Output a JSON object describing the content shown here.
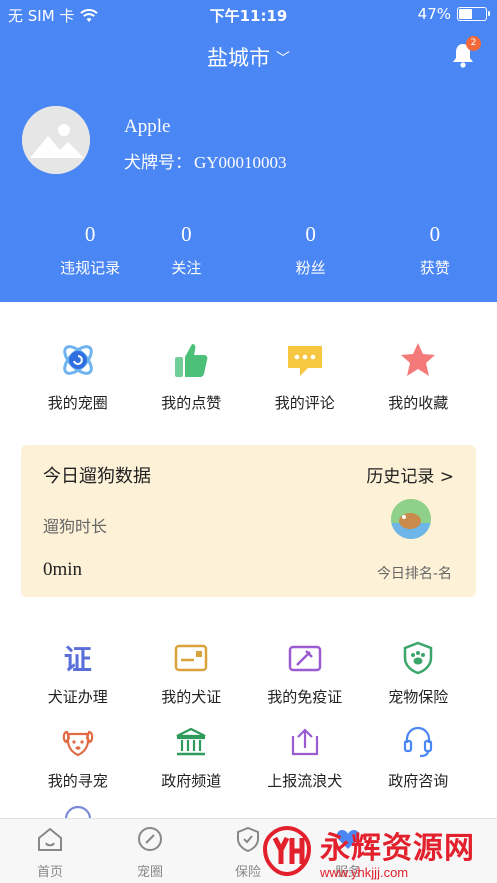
{
  "status_bar": {
    "carrier": "无 SIM 卡",
    "time": "下午11:19",
    "battery": "47%",
    "battery_level": 0.47
  },
  "header": {
    "city": "盐城市",
    "notification_count": "2",
    "user_name": "Apple",
    "dog_tag_label": "犬牌号：",
    "dog_tag_value": "GY00010003",
    "stats": [
      {
        "value": "0",
        "label": "违规记录"
      },
      {
        "value": "0",
        "label": "关注"
      },
      {
        "value": "0",
        "label": "粉丝"
      },
      {
        "value": "0",
        "label": "获赞"
      }
    ]
  },
  "quick_links": [
    {
      "label": "我的宠圈",
      "icon": "pet-circle-icon"
    },
    {
      "label": "我的点赞",
      "icon": "thumbs-up-icon"
    },
    {
      "label": "我的评论",
      "icon": "comment-icon"
    },
    {
      "label": "我的收藏",
      "icon": "star-icon"
    }
  ],
  "walk_card": {
    "title": "今日遛狗数据",
    "history": "历史记录 >",
    "duration_label": "遛狗时长",
    "duration_value": "0min",
    "rank": "今日排名-名"
  },
  "services": [
    {
      "label": "犬证办理",
      "icon": "license-icon"
    },
    {
      "label": "我的犬证",
      "icon": "card-icon"
    },
    {
      "label": "我的免疫证",
      "icon": "vaccine-icon"
    },
    {
      "label": "宠物保险",
      "icon": "shield-paw-icon"
    },
    {
      "label": "我的寻宠",
      "icon": "dog-face-icon"
    },
    {
      "label": "政府频道",
      "icon": "government-icon"
    },
    {
      "label": "上报流浪犬",
      "icon": "upload-icon"
    },
    {
      "label": "政府咨询",
      "icon": "headset-icon"
    }
  ],
  "tabs": [
    {
      "label": "首页",
      "icon": "home-icon"
    },
    {
      "label": "宠圈",
      "icon": "compass-icon"
    },
    {
      "label": "保险",
      "icon": "shield-icon"
    },
    {
      "label": "服务",
      "icon": "service-icon"
    }
  ],
  "watermark": {
    "brand": "永辉资源网",
    "url": "www.yhkjjj.com"
  },
  "colors": {
    "brand_blue": "#4a86f4",
    "card_bg": "#fdf1d8",
    "badge": "#f26a3c"
  }
}
